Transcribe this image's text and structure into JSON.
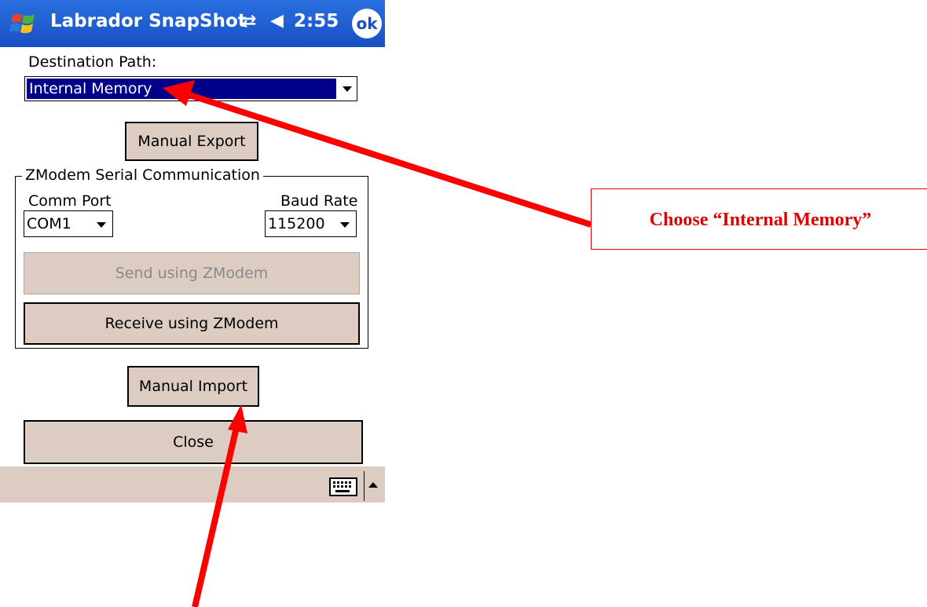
{
  "titlebar": {
    "title": "Labrador SnapShot",
    "time": "2:55",
    "ok_label": "ok",
    "icons": [
      "windows-start-icon",
      "connectivity-icon",
      "speaker-icon"
    ]
  },
  "destination": {
    "label": "Destination Path:",
    "selected": "Internal Memory"
  },
  "buttons": {
    "manual_export": "Manual Export",
    "send_zmodem": "Send using ZModem",
    "receive_zmodem": "Receive using ZModem",
    "manual_import": "Manual Import",
    "close": "Close"
  },
  "zmodem": {
    "group_title": "ZModem Serial Communication",
    "comm_port_label": "Comm Port",
    "comm_port_value": "COM1",
    "baud_rate_label": "Baud Rate",
    "baud_rate_value": "115200"
  },
  "annotation": {
    "callout_text": "Choose “Internal Memory”",
    "arrow_color": "#ff0000"
  },
  "colors": {
    "titlebar": "#1650c4",
    "button_face": "#dcccc2",
    "selection": "#00008b",
    "callout": "#e00000"
  }
}
